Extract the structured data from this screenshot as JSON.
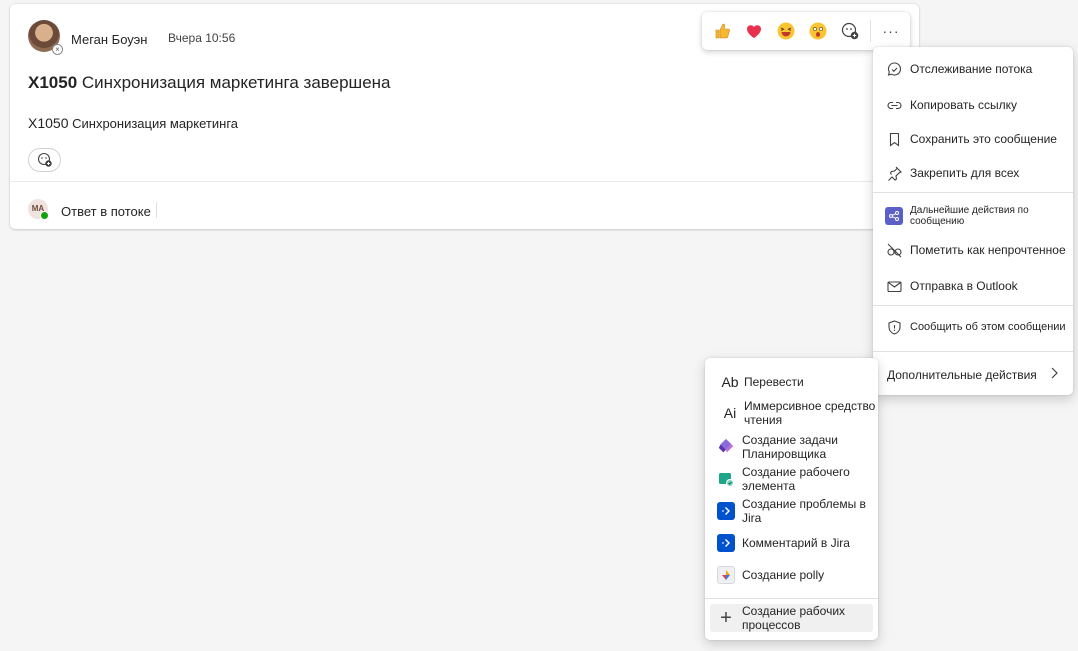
{
  "message": {
    "author": "Меган Боуэн",
    "time": "Вчера 10:56",
    "title_code": "X1050",
    "title_text": "Синхронизация маркетинга завершена",
    "body_code": "X1050",
    "body_text": "Синхронизация маркетинга",
    "reply_avatar_initials": "MA",
    "reply_label": "Ответ в потоке"
  },
  "reactions": [
    {
      "name": "like",
      "glyph": "👍"
    },
    {
      "name": "heart",
      "glyph": "❤"
    },
    {
      "name": "laugh",
      "glyph": "😆"
    },
    {
      "name": "surprised",
      "glyph": "😮"
    },
    {
      "name": "add-reaction",
      "glyph": "☺"
    }
  ],
  "toolbar": {
    "more_label": "···"
  },
  "context_menu": [
    {
      "label": "Отслеживание потока",
      "icon": "follow-thread-icon"
    },
    {
      "label": "Копировать ссылку",
      "icon": "link-icon"
    },
    {
      "label": "Сохранить это сообщение",
      "icon": "bookmark-icon"
    },
    {
      "label": "Закрепить для всех",
      "icon": "pin-icon"
    },
    {
      "label": "Дальнейшие действия по сообщению",
      "icon": "loop-icon"
    },
    {
      "label": "Пометить как непрочтенное",
      "icon": "unread-icon"
    },
    {
      "label": "Отправка в Outlook",
      "icon": "mail-icon"
    },
    {
      "label": "Сообщить об этом сообщении",
      "icon": "shield-icon"
    },
    {
      "label": "Дополнительные действия",
      "icon": "chevron-right-icon"
    }
  ],
  "submenu": [
    {
      "label": "Перевести",
      "icon": "translate-icon",
      "glyph": "Ab"
    },
    {
      "label": "Иммерсивное средство чтения",
      "icon": "immersive-reader-icon",
      "glyph": "Ai"
    },
    {
      "label": "Создание задачи Планировщика",
      "icon": "planner-icon"
    },
    {
      "label": "Создание рабочего элемента",
      "icon": "work-item-icon"
    },
    {
      "label": "Создание проблемы в Jira",
      "icon": "jira-icon"
    },
    {
      "label": "Комментарий в Jira",
      "icon": "jira-icon"
    },
    {
      "label": "Создание polly",
      "icon": "polly-icon"
    },
    {
      "label": "Создание рабочих процессов",
      "icon": "plus-icon",
      "glyph": "+"
    }
  ],
  "colors": {
    "accent": "#5b5fc7",
    "jira": "#0052cc",
    "online": "#13a10e"
  }
}
